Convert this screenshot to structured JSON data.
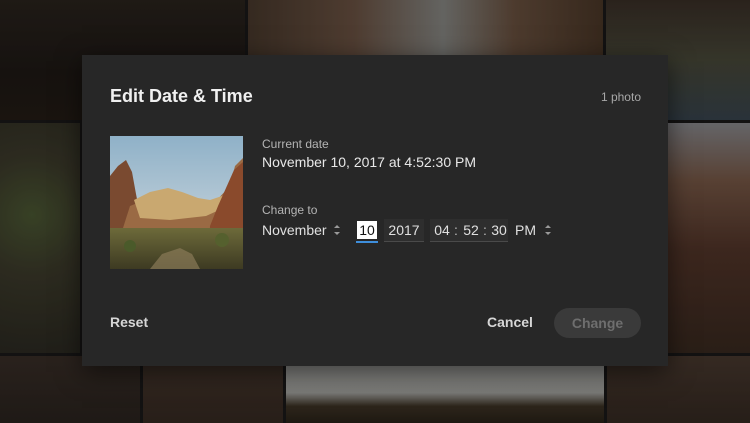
{
  "dialog": {
    "title": "Edit Date & Time",
    "photo_count": "1 photo",
    "current_label": "Current date",
    "current_value": "November 10, 2017 at 4:52:30 PM",
    "change_label": "Change to",
    "month": "November",
    "day": "10",
    "year": "2017",
    "hour": "04",
    "minute": "52",
    "second": "30",
    "time_sep": ":",
    "meridiem": "PM",
    "reset_label": "Reset",
    "cancel_label": "Cancel",
    "change_button_label": "Change",
    "change_button_enabled": false
  },
  "colors": {
    "dialog_bg": "#272727",
    "focus_underline": "#3e8edb",
    "disabled_button_bg": "#3a3a3a",
    "disabled_button_text": "#6e6e6e"
  },
  "icons": [
    "spinner-icon"
  ]
}
